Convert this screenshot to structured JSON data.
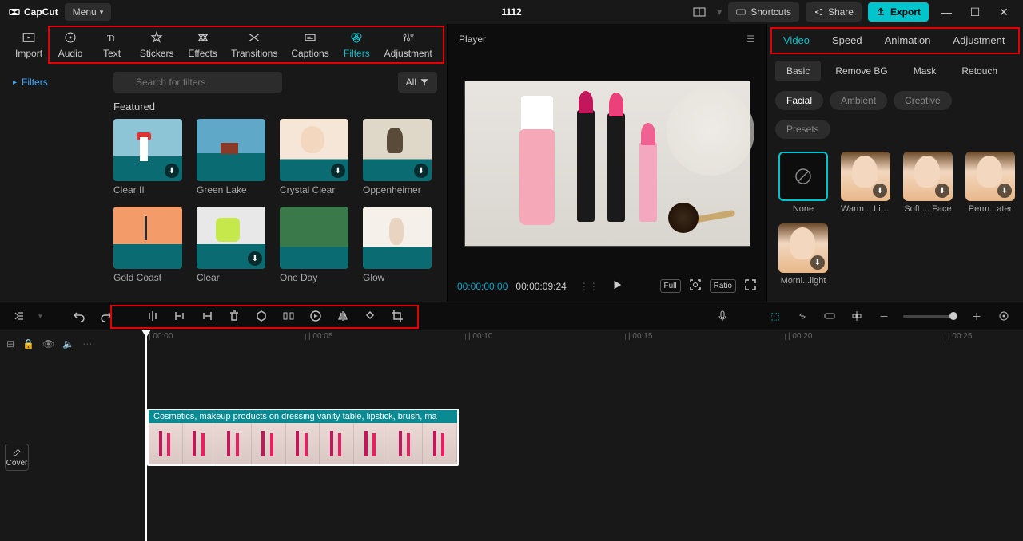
{
  "titlebar": {
    "app": "CapCut",
    "menu": "Menu",
    "project": "1112",
    "shortcuts": "Shortcuts",
    "share": "Share",
    "export": "Export"
  },
  "toolTabs": {
    "import": "Import",
    "audio": "Audio",
    "text": "Text",
    "stickers": "Stickers",
    "effects": "Effects",
    "transitions": "Transitions",
    "captions": "Captions",
    "filters": "Filters",
    "adjustment": "Adjustment"
  },
  "sidebar": {
    "filters": "Filters"
  },
  "search": {
    "placeholder": "Search for filters",
    "all": "All"
  },
  "featured": {
    "title": "Featured",
    "items": [
      {
        "name": "Clear II"
      },
      {
        "name": "Green Lake"
      },
      {
        "name": "Crystal Clear"
      },
      {
        "name": "Oppenheimer"
      },
      {
        "name": "Gold Coast"
      },
      {
        "name": "Clear"
      },
      {
        "name": "One Day"
      },
      {
        "name": "Glow"
      }
    ]
  },
  "player": {
    "title": "Player",
    "current": "00:00:00:00",
    "duration": "00:00:09:24",
    "full": "Full",
    "ratio": "Ratio"
  },
  "propTabs": {
    "video": "Video",
    "speed": "Speed",
    "animation": "Animation",
    "adjustment": "Adjustment"
  },
  "subTabs": {
    "basic": "Basic",
    "removebg": "Remove BG",
    "mask": "Mask",
    "retouch": "Retouch"
  },
  "chips": {
    "facial": "Facial",
    "ambient": "Ambient",
    "creative": "Creative",
    "presets": "Presets"
  },
  "presets": [
    {
      "name": "None"
    },
    {
      "name": "Warm ...Light"
    },
    {
      "name": "Soft ... Face"
    },
    {
      "name": "Perm...ater"
    },
    {
      "name": "Morni...light"
    }
  ],
  "cover": "Cover",
  "clip": {
    "title": "Cosmetics, makeup products on dressing vanity table, lipstick, brush, ma"
  },
  "ruler": [
    "00:00",
    "00:05",
    "00:10",
    "00:15",
    "00:20",
    "00:25"
  ]
}
